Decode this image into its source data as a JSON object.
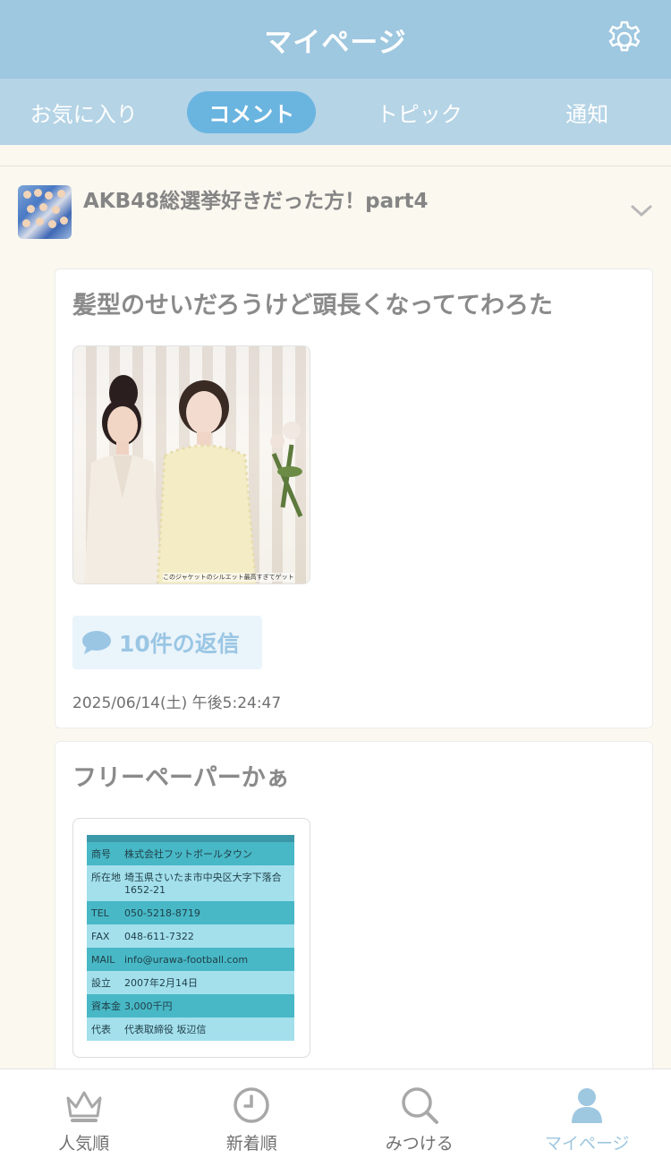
{
  "header": {
    "title": "マイページ",
    "settings_icon": "gear-icon"
  },
  "tabs": [
    {
      "label": "お気に入り",
      "active": false
    },
    {
      "label": "コメント",
      "active": true
    },
    {
      "label": "トピック",
      "active": false
    },
    {
      "label": "通知",
      "active": false
    }
  ],
  "thread": {
    "title": "AKB48総選挙好きだった方！part4",
    "expand_icon": "chevron-down-icon"
  },
  "comments": [
    {
      "text": "髪型のせいだろうけど頭長くなっててわろた",
      "image_caption": "このジャケットのシルエット最高すぎてゲット",
      "reply_label": "10件の返信",
      "date": "2025/06/14(土) 午後5:24:47"
    },
    {
      "text": "フリーペーパーかぁ",
      "table": [
        {
          "k": "商号",
          "v": "株式会社フットボールタウン"
        },
        {
          "k": "所在地",
          "v": "埼玉県さいたま市中央区大字下落合1652-21"
        },
        {
          "k": "TEL",
          "v": "050-5218-8719"
        },
        {
          "k": "FAX",
          "v": "048-611-7322"
        },
        {
          "k": "MAIL",
          "v": "info@urawa-football.com"
        },
        {
          "k": "設立",
          "v": "2007年2月14日"
        },
        {
          "k": "資本金",
          "v": "3,000千円"
        },
        {
          "k": "代表",
          "v": "代表取締役 坂辺信"
        }
      ]
    }
  ],
  "bottom_nav": [
    {
      "label": "人気順",
      "icon": "crown-icon",
      "active": false
    },
    {
      "label": "新着順",
      "icon": "clock-icon",
      "active": false
    },
    {
      "label": "みつける",
      "icon": "search-icon",
      "active": false
    },
    {
      "label": "マイページ",
      "icon": "user-icon",
      "active": true
    }
  ],
  "colors": {
    "header": "#9ec7e0",
    "tabs": "#b5d4e6",
    "active_tab": "#6ab4e0",
    "accent": "#9ac6e4"
  }
}
